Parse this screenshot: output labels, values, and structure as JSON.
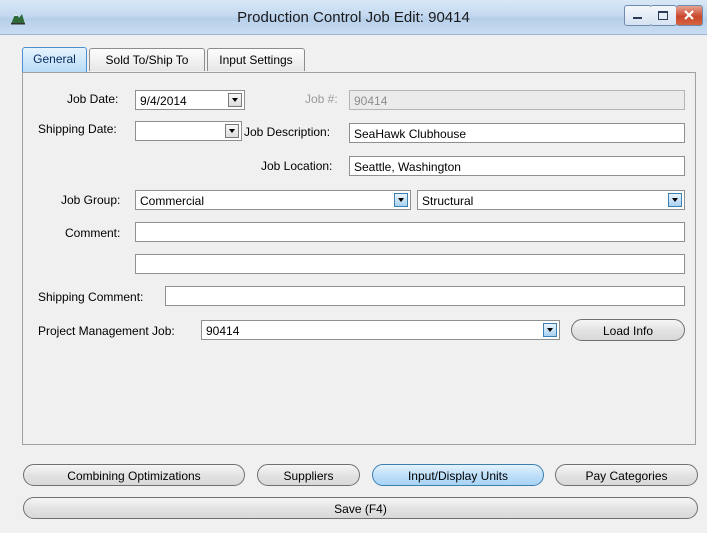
{
  "window": {
    "title": "Production Control Job Edit: 90414"
  },
  "tabs": [
    {
      "label": "General"
    },
    {
      "label": "Sold To/Ship To"
    },
    {
      "label": "Input Settings"
    }
  ],
  "form": {
    "job_date_label": "Job Date:",
    "job_date_value": "9/4/2014",
    "job_number_label": "Job #:",
    "job_number_value": "90414",
    "shipping_date_label": "Shipping Date:",
    "shipping_date_value": "",
    "job_description_label": "Job Description:",
    "job_description_value": "SeaHawk Clubhouse",
    "job_location_label": "Job Location:",
    "job_location_value": "Seattle, Washington",
    "job_group_label": "Job Group:",
    "job_group_value": "Commercial",
    "job_group_sub_value": "Structural",
    "comment_label": "Comment:",
    "comment_line1": "",
    "comment_line2": "",
    "shipping_comment_label": "Shipping Comment:",
    "shipping_comment_value": "",
    "pm_job_label": "Project Management Job:",
    "pm_job_value": "90414",
    "load_info_label": "Load Info"
  },
  "bottom_buttons": {
    "combining": "Combining Optimizations",
    "suppliers": "Suppliers",
    "units": "Input/Display Units",
    "pay": "Pay Categories",
    "save": "Save (F4)"
  }
}
